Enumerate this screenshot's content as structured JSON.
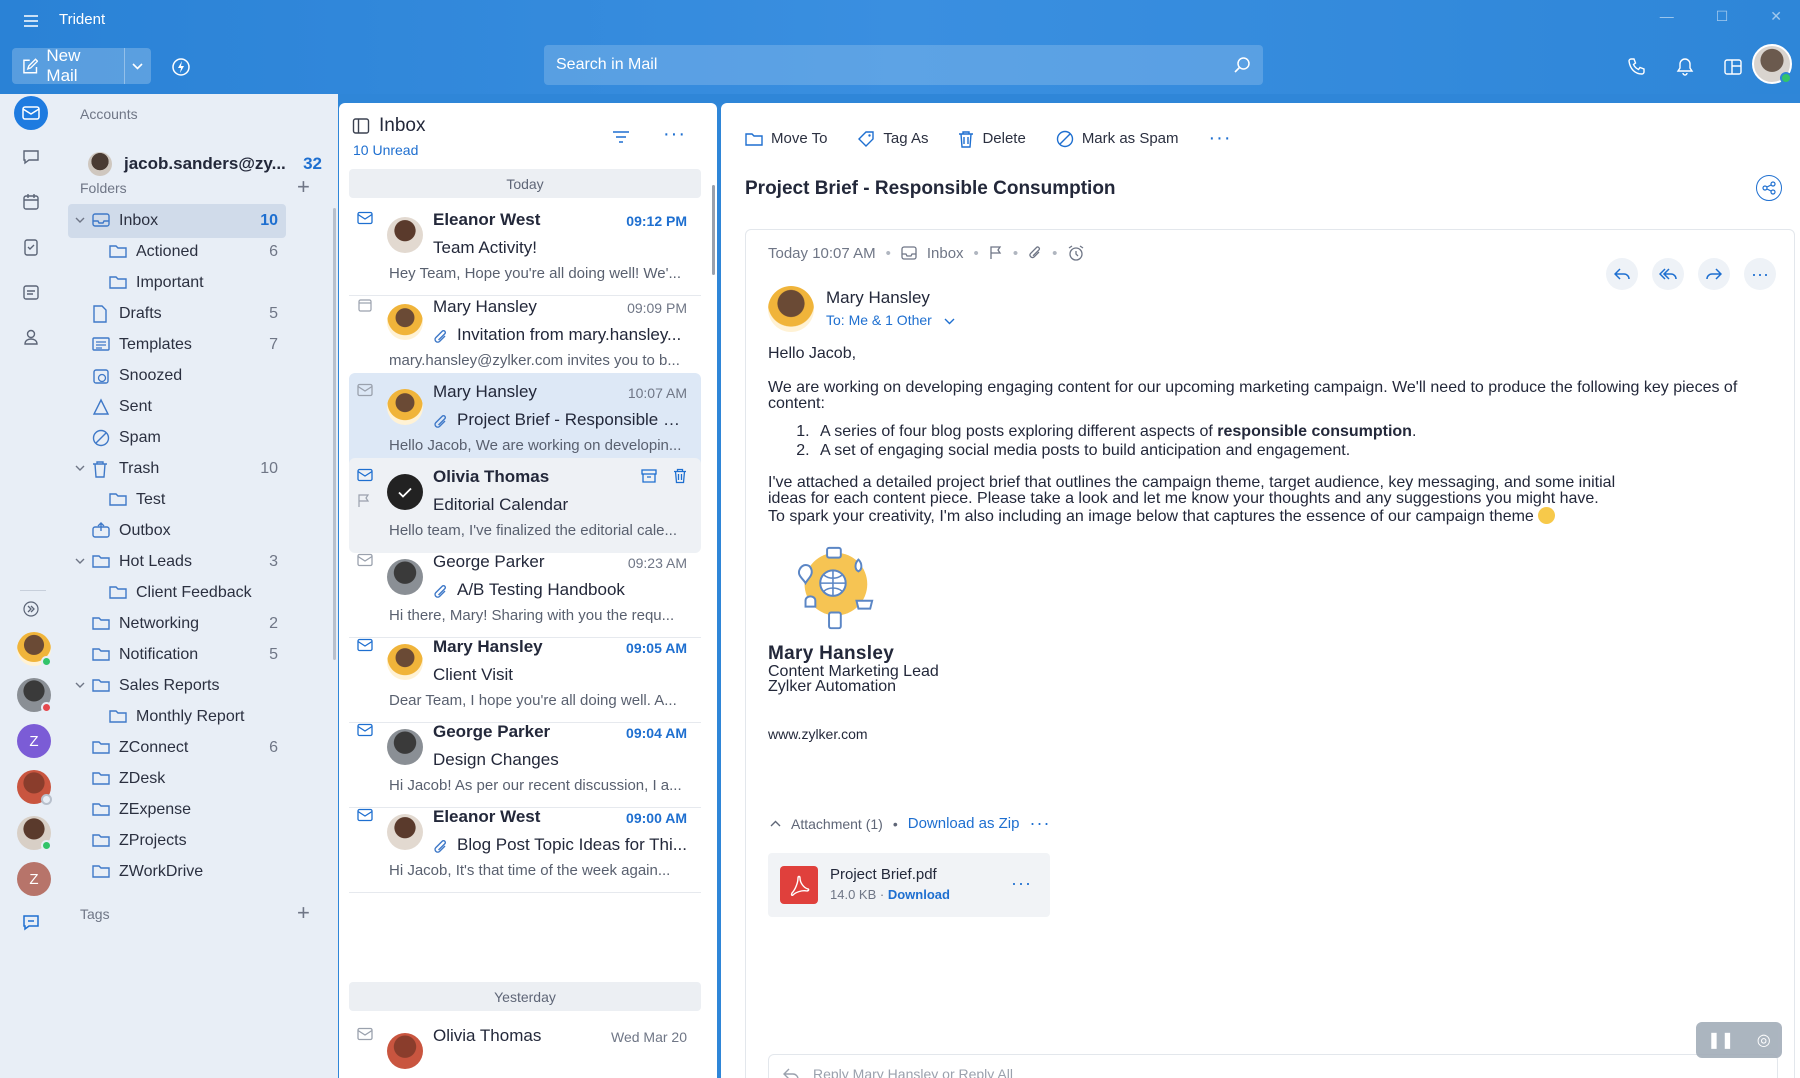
{
  "app": {
    "title": "Trident"
  },
  "toolbar_top": {
    "new_mail_label": "New Mail",
    "search_placeholder": "Search in Mail"
  },
  "accounts": {
    "heading": "Accounts",
    "email": "jacob.sanders@zy...",
    "count": "32"
  },
  "folders": {
    "heading": "Folders",
    "items": [
      {
        "label": "Inbox",
        "count": "10"
      },
      {
        "label": "Actioned",
        "count": "6"
      },
      {
        "label": "Important",
        "count": ""
      },
      {
        "label": "Drafts",
        "count": "5"
      },
      {
        "label": "Templates",
        "count": "7"
      },
      {
        "label": "Snoozed",
        "count": ""
      },
      {
        "label": "Sent",
        "count": ""
      },
      {
        "label": "Spam",
        "count": ""
      },
      {
        "label": "Trash",
        "count": "10"
      },
      {
        "label": "Test",
        "count": ""
      },
      {
        "label": "Outbox",
        "count": ""
      },
      {
        "label": "Hot Leads",
        "count": "3"
      },
      {
        "label": "Client Feedback",
        "count": ""
      },
      {
        "label": "Networking",
        "count": "2"
      },
      {
        "label": "Notification",
        "count": "5"
      },
      {
        "label": "Sales Reports",
        "count": ""
      },
      {
        "label": "Monthly Report",
        "count": ""
      },
      {
        "label": "ZConnect",
        "count": "6"
      },
      {
        "label": "ZDesk",
        "count": ""
      },
      {
        "label": "ZExpense",
        "count": ""
      },
      {
        "label": "ZProjects",
        "count": ""
      },
      {
        "label": "ZWorkDrive",
        "count": ""
      }
    ],
    "tags_heading": "Tags"
  },
  "rail": {
    "avatar_letters": [
      "Z",
      "Z"
    ]
  },
  "list": {
    "title": "Inbox",
    "unread": "10 Unread",
    "day_today": "Today",
    "day_yesterday": "Yesterday",
    "messages": [
      {
        "from": "Eleanor West",
        "time": "09:12 PM",
        "subject": "Team Activity!",
        "preview": "Hey Team, Hope you're all doing well! We'..."
      },
      {
        "from": "Mary Hansley",
        "time": "09:09 PM",
        "subject": "Invitation from mary.hansley...",
        "preview": "mary.hansley@zylker.com invites you to b..."
      },
      {
        "from": "Mary Hansley",
        "time": "10:07 AM",
        "subject": "Project Brief - Responsible C...",
        "preview": "Hello Jacob, We are working on developin..."
      },
      {
        "from": "Olivia Thomas",
        "time": "",
        "subject": "Editorial Calendar",
        "preview": "Hello team, I've finalized the editorial cale..."
      },
      {
        "from": "George Parker",
        "time": "09:23 AM",
        "subject": "A/B Testing Handbook",
        "preview": "Hi there, Mary! Sharing with you the requ..."
      },
      {
        "from": "Mary Hansley",
        "time": "09:05 AM",
        "subject": "Client Visit",
        "preview": "Dear Team, I hope you're all doing well. A..."
      },
      {
        "from": "George Parker",
        "time": "09:04 AM",
        "subject": "Design Changes",
        "preview": "Hi Jacob! As per our recent discussion, I a..."
      },
      {
        "from": "Eleanor West",
        "time": "09:00 AM",
        "subject": "Blog Post Topic Ideas for Thi...",
        "preview": "Hi Jacob, It's that time of the week again..."
      },
      {
        "from": "Olivia Thomas",
        "time": "Wed Mar 20",
        "subject": "",
        "preview": ""
      }
    ]
  },
  "reader": {
    "toolbar": {
      "move_to": "Move To",
      "tag_as": "Tag As",
      "delete": "Delete",
      "mark_spam": "Mark as Spam"
    },
    "subject": "Project Brief - Responsible Consumption",
    "meta_time": "Today 10:07 AM",
    "meta_folder": "Inbox",
    "sender_name": "Mary Hansley",
    "recipients": "To: Me & 1 Other",
    "greeting": "Hello Jacob,",
    "para1": "We are working on developing engaging content for our upcoming marketing campaign. We'll need to produce the following key pieces of content:",
    "list1_pre": "A series of four blog posts exploring different aspects of ",
    "list1_bold": "responsible consumption",
    "list1_post": ".",
    "list2": "A set of engaging social media posts to build anticipation and engagement.",
    "para2_l1": "I've attached a detailed project brief that outlines the campaign theme, target audience, key messaging, and some initial",
    "para2_l2": "ideas for each content piece. Please take a look and let me know your thoughts and any suggestions you might have.",
    "para2_l3": "To spark your creativity, I'm also including an image below that captures the essence of our campaign theme",
    "sig_name": "Mary Hansley",
    "sig_title": "Content Marketing Lead",
    "sig_company": "Zylker Automation",
    "website": "www.zylker.com",
    "attachment_header": "Attachment (1)",
    "download_zip": "Download as Zip",
    "file_name": "Project Brief.pdf",
    "file_size": "14.0 KB",
    "file_download": "Download",
    "reply_placeholder": "Reply Mary Hansley or Reply All"
  },
  "colors": {
    "accent": "#1e6fd0",
    "titlebar": "#2f86d8",
    "online": "#32c46a",
    "busy": "#e5484d"
  }
}
